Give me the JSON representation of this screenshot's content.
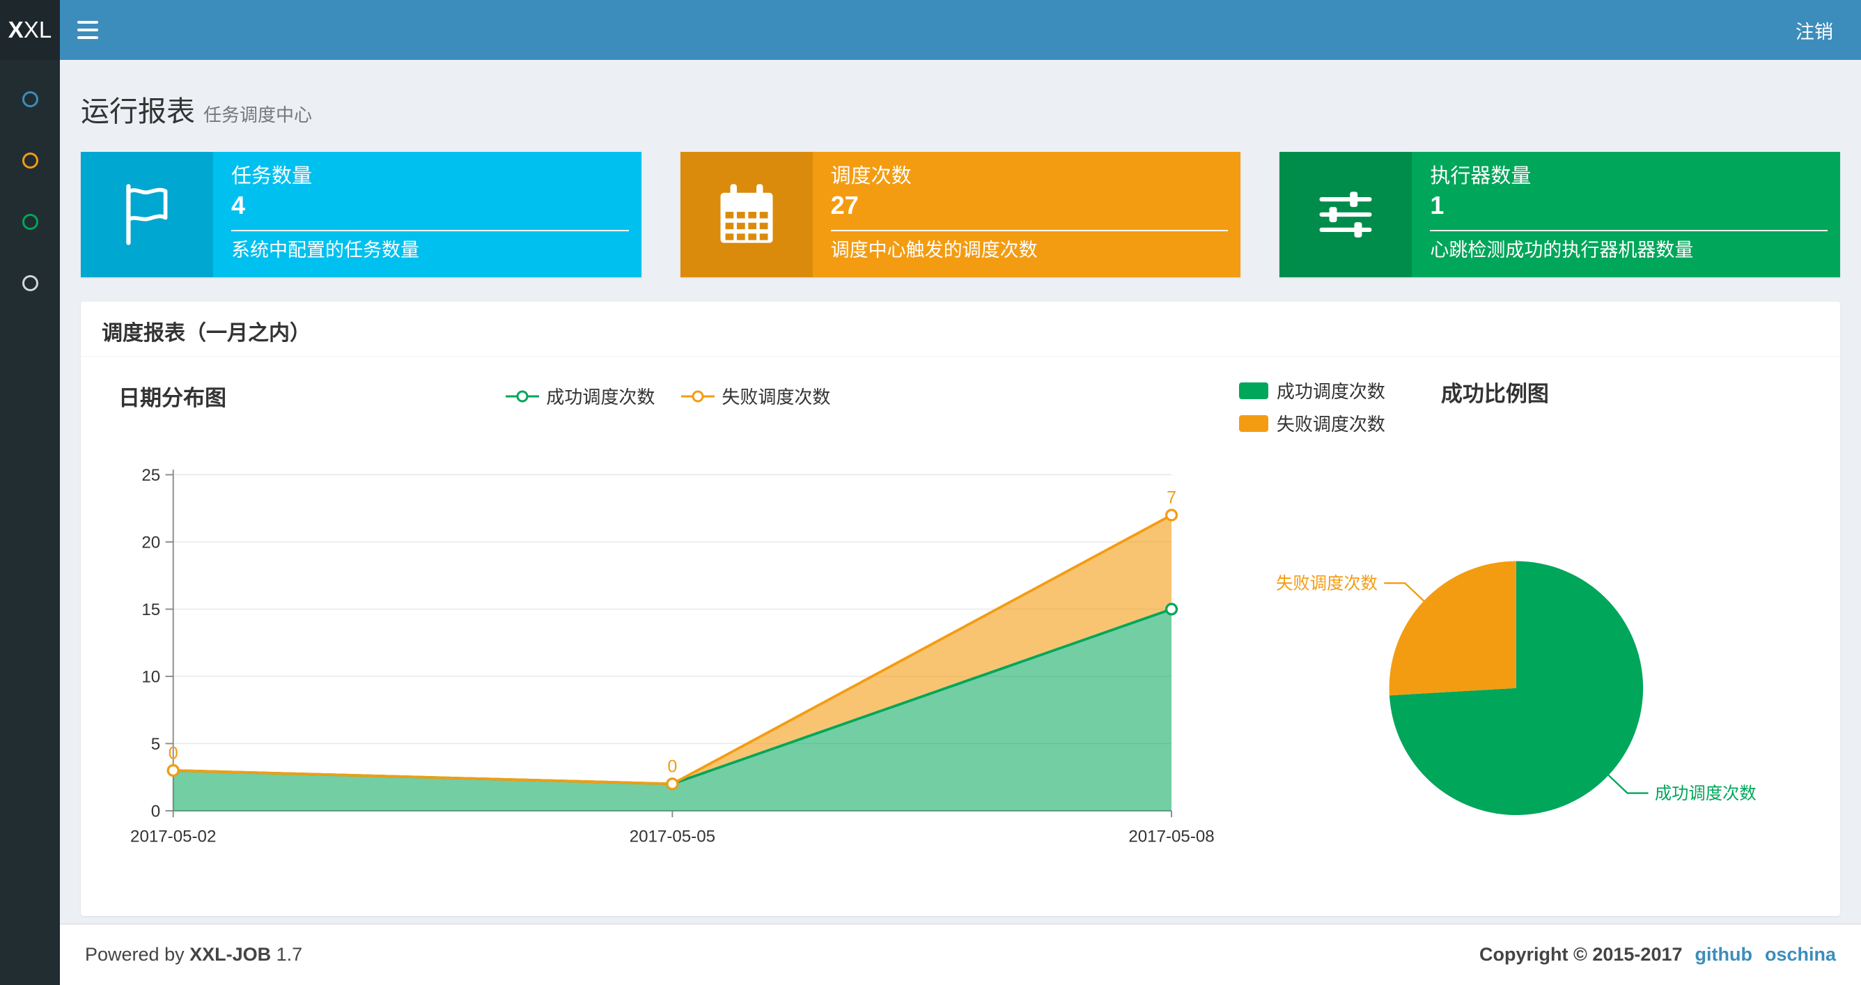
{
  "navbar": {
    "logo_bold": "X",
    "logo_rest": "XL",
    "logout_label": "注销"
  },
  "sidebar": {
    "items": [
      {
        "name": "report",
        "color": "#3c8dbc"
      },
      {
        "name": "jobs",
        "color": "#f39c12"
      },
      {
        "name": "logs",
        "color": "#00a65a"
      },
      {
        "name": "executors",
        "color": "#d2d6de"
      }
    ]
  },
  "page": {
    "title": "运行报表",
    "subtitle": "任务调度中心"
  },
  "info_boxes": [
    {
      "title": "任务数量",
      "number": "4",
      "desc": "系统中配置的任务数量",
      "bg": "#00c0ef",
      "icon_bg": "#00a7d0",
      "icon": "flag-icon"
    },
    {
      "title": "调度次数",
      "number": "27",
      "desc": "调度中心触发的调度次数",
      "bg": "#f39c12",
      "icon_bg": "#db8b0b",
      "icon": "calendar-icon"
    },
    {
      "title": "执行器数量",
      "number": "1",
      "desc": "心跳检测成功的执行器机器数量",
      "bg": "#00a65a",
      "icon_bg": "#008d4c",
      "icon": "sliders-icon"
    }
  ],
  "panel": {
    "title": "调度报表（一月之内）"
  },
  "chart_data": [
    {
      "type": "area",
      "title": "日期分布图",
      "x": [
        "2017-05-02",
        "2017-05-05",
        "2017-05-08"
      ],
      "series": [
        {
          "name": "成功调度次数",
          "values": [
            3,
            2,
            15
          ],
          "color": "#00a65a"
        },
        {
          "name": "失败调度次数",
          "values": [
            0,
            0,
            7
          ],
          "color": "#f39c12"
        }
      ],
      "stacked": true,
      "point_labels_series": "失败调度次数",
      "ylim": [
        0,
        25
      ],
      "yticks": [
        0,
        5,
        10,
        15,
        20,
        25
      ],
      "grid": true,
      "legend_position": "top-center"
    },
    {
      "type": "pie",
      "title": "成功比例图",
      "slices": [
        {
          "name": "成功调度次数",
          "value": 20,
          "color": "#00a65a"
        },
        {
          "name": "失败调度次数",
          "value": 7,
          "color": "#f39c12"
        }
      ],
      "legend_position": "top-left"
    }
  ],
  "footer": {
    "powered_by": "Powered by",
    "brand": "XXL-JOB",
    "version": "1.7",
    "copyright": "Copyright © 2015-2017",
    "links": [
      {
        "label": "github"
      },
      {
        "label": "oschina"
      }
    ]
  }
}
